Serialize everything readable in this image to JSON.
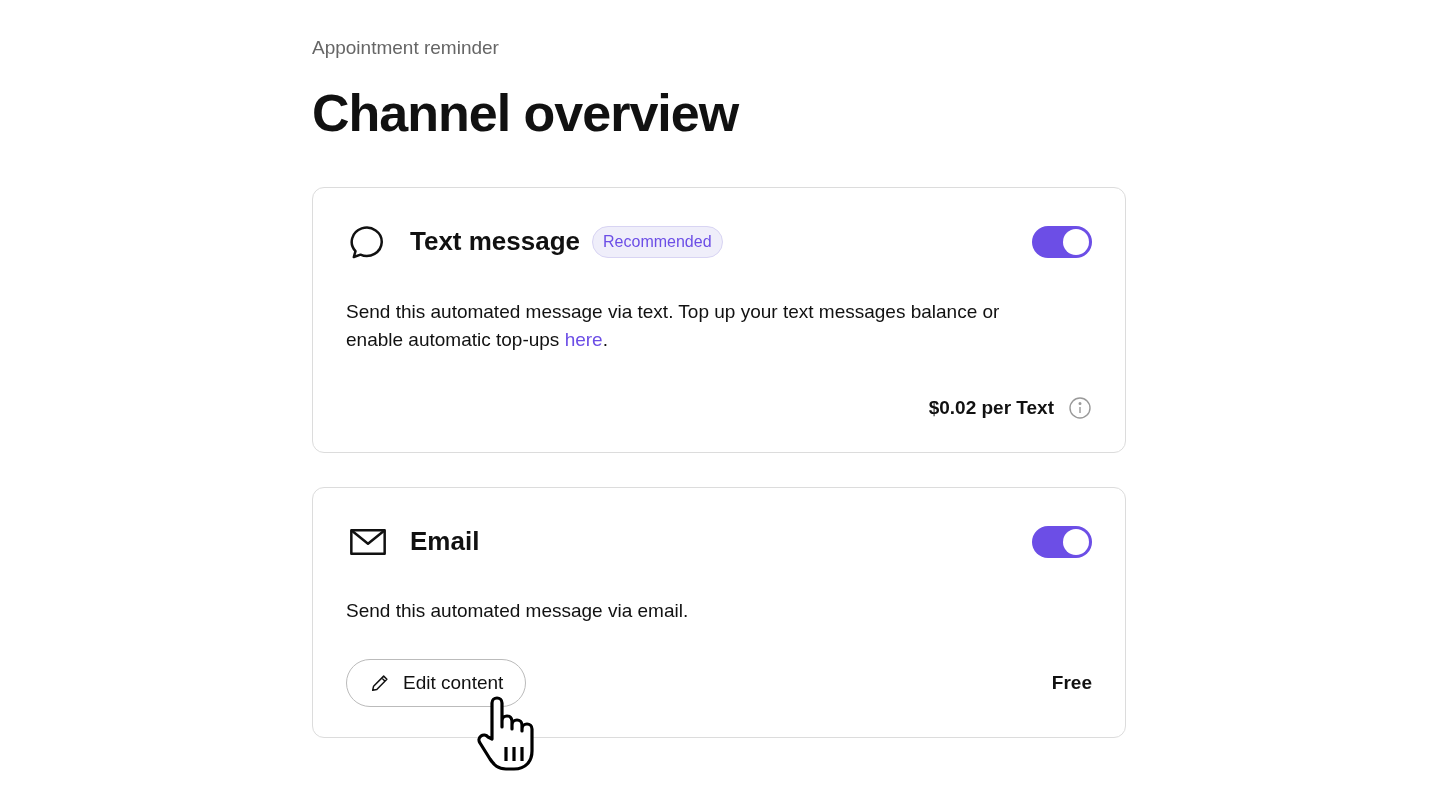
{
  "breadcrumb": "Appointment reminder",
  "title": "Channel overview",
  "channels": [
    {
      "kind": "sms",
      "name": "Text message",
      "badge": "Recommended",
      "on": true,
      "description": "Send this automated message via text. Top up your text messages balance or enable automatic top-ups ",
      "link": "here",
      "description_end": ".",
      "price": "$0.02 per Text",
      "info": true
    },
    {
      "kind": "email",
      "name": "Email",
      "on": true,
      "description": "Send this automated message via email.",
      "button": "Edit content",
      "price": "Free",
      "info": false
    }
  ]
}
